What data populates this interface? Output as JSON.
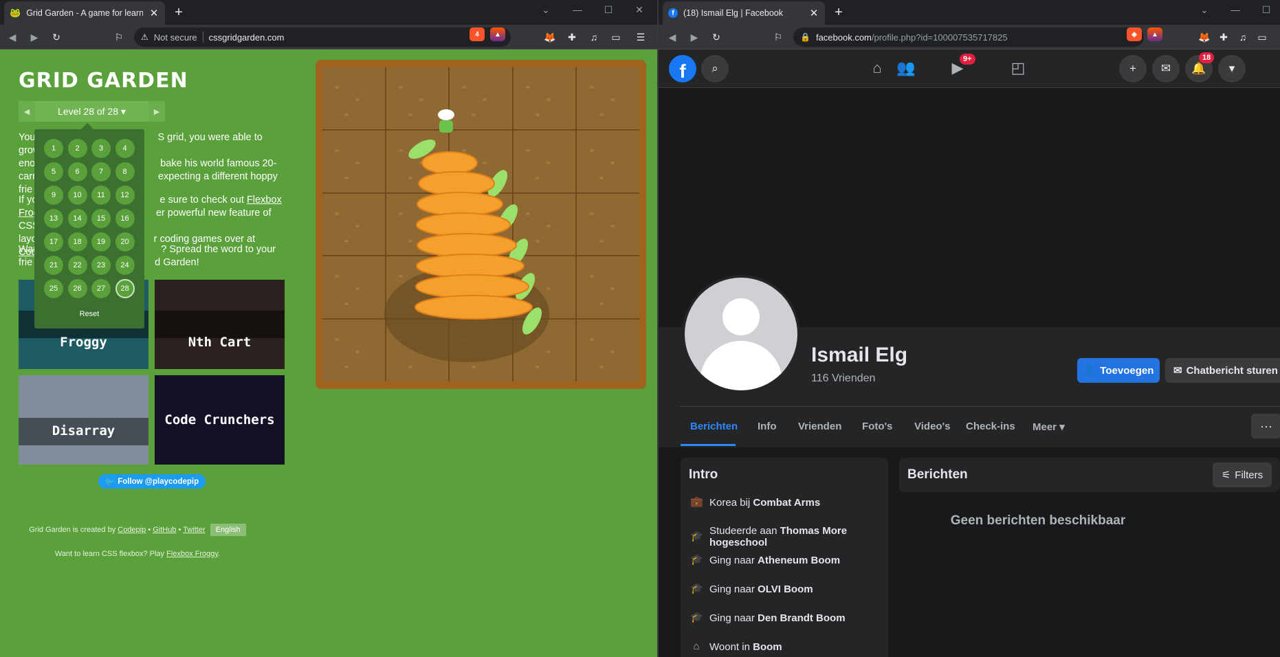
{
  "left_browser": {
    "tab_title": "Grid Garden - A game for learnin",
    "security_label": "Not secure",
    "url": "cssgridgarden.com",
    "brave_badge": "4"
  },
  "gridgarden": {
    "logo": "GRID GARDEN",
    "level_label": "Level 28 of 28",
    "levels": [
      "1",
      "2",
      "3",
      "4",
      "5",
      "6",
      "7",
      "8",
      "9",
      "10",
      "11",
      "12",
      "13",
      "14",
      "15",
      "16",
      "17",
      "18",
      "19",
      "20",
      "21",
      "22",
      "23",
      "24",
      "25",
      "26",
      "27",
      "28"
    ],
    "current_level": "28",
    "reset": "Reset",
    "p1_lines": [
      "You",
      "S grid, you were able to grow",
      "eno",
      "bake his world famous 20-",
      "carr",
      "expecting a different hoppy",
      "frie"
    ],
    "p2_lines": [
      "If yo",
      "e sure to check out",
      "Flexbox",
      "Frog",
      "er powerful new feature of CSS",
      "layo",
      "r coding games over at",
      "Codepip"
    ],
    "p3_lines": [
      "Wan",
      "? Spread the word to your",
      "frie",
      "d Garden!"
    ],
    "cards": [
      "Froggy",
      "Nth Cart",
      "Disarray",
      "Code Crunchers"
    ],
    "follow": "Follow @playcodepip",
    "footer1_prefix": "Grid Garden is created by",
    "footer1_links": [
      "Codepip",
      "GitHub",
      "Twitter"
    ],
    "language": "English",
    "footer2_prefix": "Want to learn CSS flexbox? Play",
    "footer2_link": "Flexbox Froggy"
  },
  "right_browser": {
    "tab_title": "(18) Ismail Elg | Facebook",
    "url_main": "facebook.com",
    "url_rest": "/profile.php?id=100007535717825"
  },
  "facebook": {
    "video_badge": "9+",
    "notif_badge": "18",
    "name": "Ismail Elg",
    "friends": "116 Vrienden",
    "add_button": "Toevoegen",
    "message_button": "Chatbericht sturen",
    "tabs": [
      "Berichten",
      "Info",
      "Vrienden",
      "Foto's",
      "Video's",
      "Check-ins",
      "Meer"
    ],
    "intro_title": "Intro",
    "intro_items": [
      {
        "pre": "Korea bij",
        "bold": "Combat Arms",
        "icon": "briefcase-icon"
      },
      {
        "pre": "Studeerde aan",
        "bold": "Thomas More hogeschool",
        "icon": "graduation-cap-icon"
      },
      {
        "pre": "Ging naar",
        "bold": "Atheneum Boom",
        "icon": "graduation-cap-icon"
      },
      {
        "pre": "Ging naar",
        "bold": "OLVI Boom",
        "icon": "graduation-cap-icon"
      },
      {
        "pre": "Ging naar",
        "bold": "Den Brandt Boom",
        "icon": "graduation-cap-icon"
      },
      {
        "pre": "Woont in",
        "bold": "Boom",
        "icon": "home-icon"
      }
    ],
    "posts_title": "Berichten",
    "filters": "Filters",
    "empty": "Geen berichten beschikbaar"
  }
}
